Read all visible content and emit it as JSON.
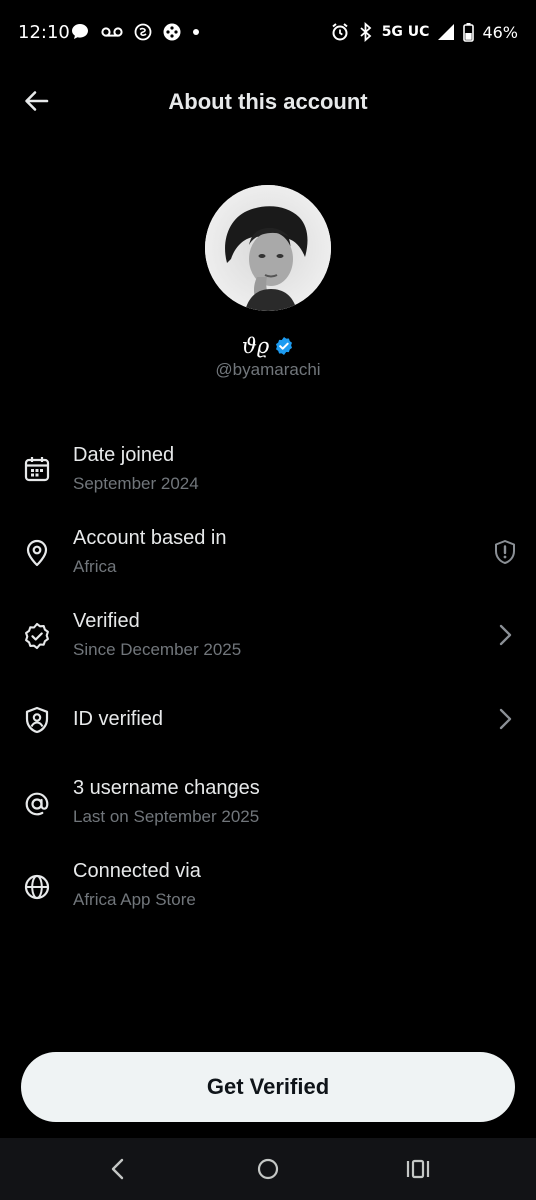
{
  "status_bar": {
    "time": "12:10",
    "network": "5G UC",
    "battery": "46%",
    "left_icons": [
      "message-icon",
      "voicemail-icon",
      "app-icon",
      "game-icon",
      "dot-icon"
    ],
    "right_icons": [
      "alarm-icon",
      "bluetooth-icon",
      "signal-icon",
      "battery-icon"
    ]
  },
  "header": {
    "title": "About this account",
    "back_icon": "back-arrow-icon"
  },
  "profile": {
    "display_name": "ϑϱ",
    "handle": "@byamarachi",
    "verified_color": "#1d9bf0"
  },
  "rows": [
    {
      "icon": "calendar-icon",
      "title": "Date joined",
      "subtitle": "September 2024",
      "trail": ""
    },
    {
      "icon": "location-pin-icon",
      "title": "Account based in",
      "subtitle": "Africa",
      "trail": "shield-alert-icon"
    },
    {
      "icon": "verified-badge-icon",
      "title": "Verified",
      "subtitle": "Since December 2025",
      "trail": "chevron-right-icon"
    },
    {
      "icon": "id-shield-icon",
      "title": "ID verified",
      "subtitle": "",
      "trail": "chevron-right-icon"
    },
    {
      "icon": "at-sign-icon",
      "title": "3 username changes",
      "subtitle": "Last on September 2025",
      "trail": ""
    },
    {
      "icon": "globe-icon",
      "title": "Connected via",
      "subtitle": "Africa App Store",
      "trail": ""
    }
  ],
  "cta": {
    "label": "Get Verified"
  },
  "nav": {
    "icons": [
      "nav-back-icon",
      "nav-home-icon",
      "nav-recents-icon"
    ]
  },
  "colors": {
    "background": "#000000",
    "text": "#e7e9ea",
    "muted": "#71767b",
    "button": "#eff3f4"
  }
}
